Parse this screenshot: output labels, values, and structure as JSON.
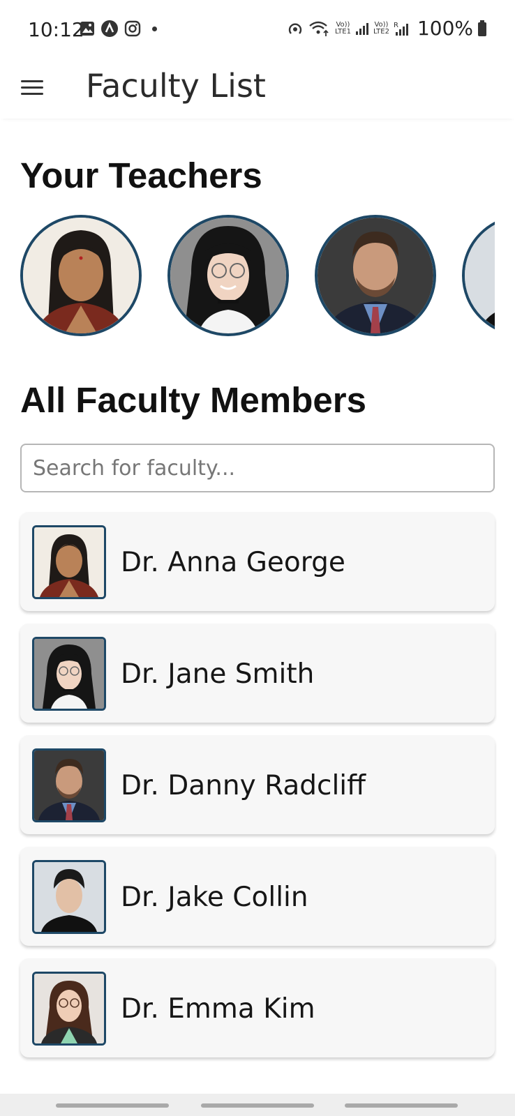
{
  "status_bar": {
    "time": "10:12",
    "lte1": "Vo))\nLTE1",
    "lte2": "Vo))\nLTE2",
    "roaming": "R",
    "battery": "100%"
  },
  "app_bar": {
    "title": "Faculty List",
    "menu_icon": "hamburger-menu-icon"
  },
  "teachers_section": {
    "title": "Your Teachers"
  },
  "faculty_section": {
    "title": "All Faculty Members",
    "search_placeholder": "Search for faculty..."
  },
  "faculty": [
    {
      "name": "Dr. Anna George"
    },
    {
      "name": "Dr. Jane Smith"
    },
    {
      "name": "Dr. Danny Radcliff"
    },
    {
      "name": "Dr. Jake Collin"
    },
    {
      "name": "Dr. Emma Kim"
    }
  ],
  "colors": {
    "accent_border": "#1e4866",
    "card_bg": "#f7f7f7"
  }
}
